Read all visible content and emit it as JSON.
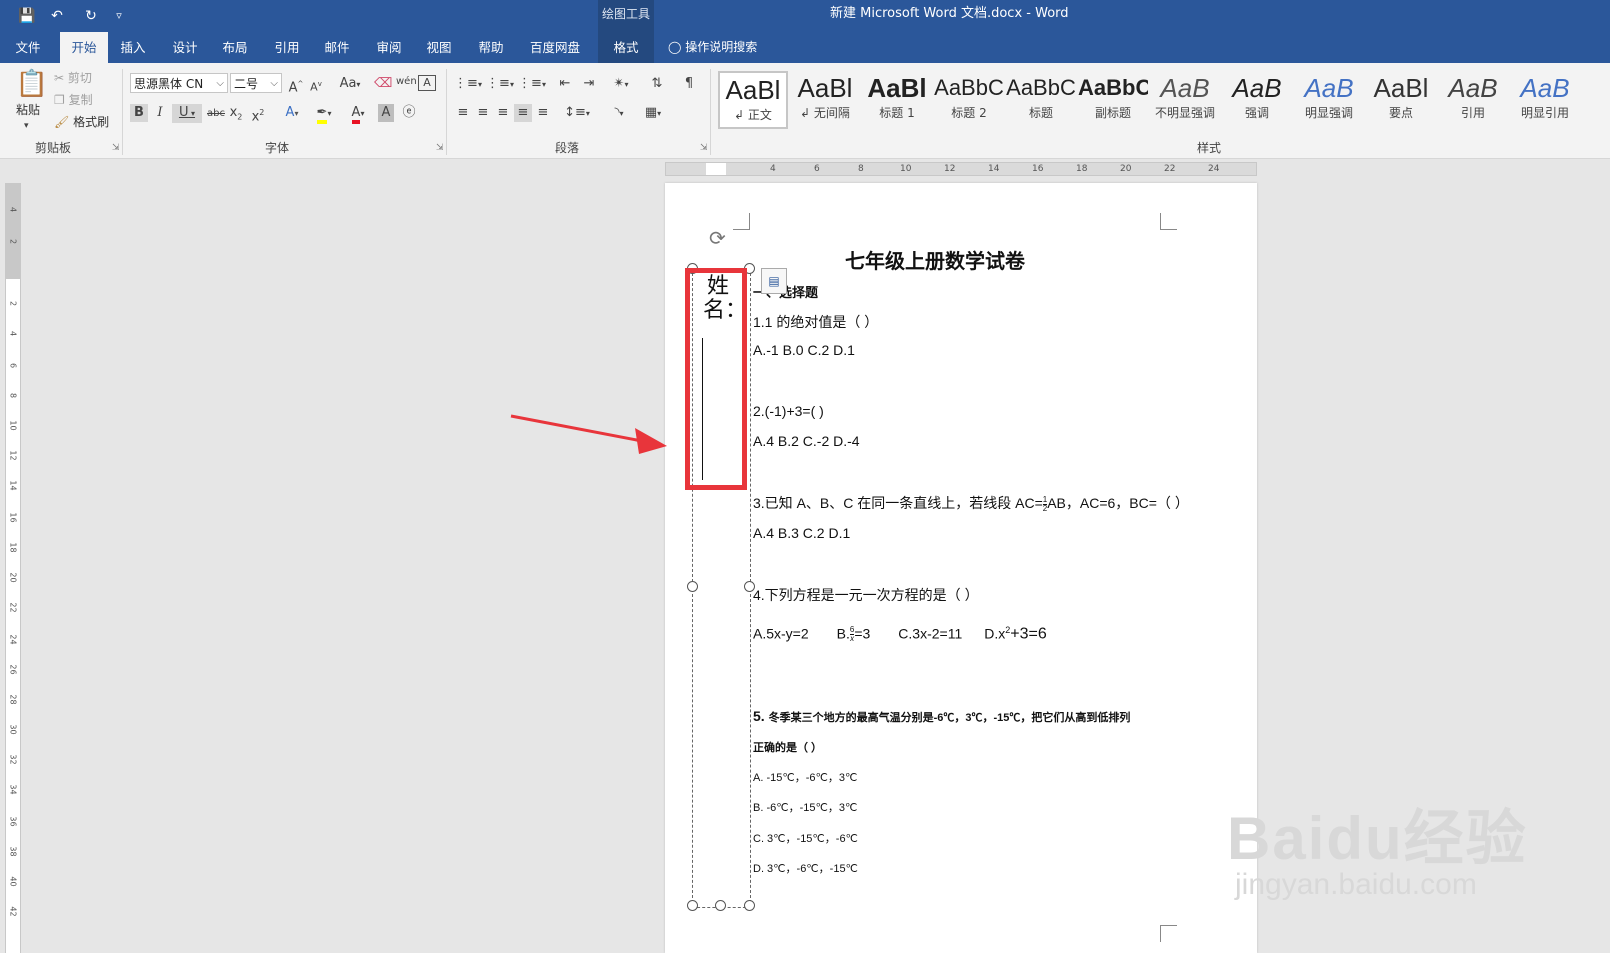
{
  "window": {
    "title": "新建 Microsoft Word 文档.docx  -  Word",
    "context_tools": "绘图工具",
    "accent": "#2b579a"
  },
  "quick_access": [
    "save-icon",
    "undo-icon",
    "redo-icon",
    "customize-icon"
  ],
  "tabs": [
    "文件",
    "开始",
    "插入",
    "设计",
    "布局",
    "引用",
    "邮件",
    "审阅",
    "视图",
    "帮助",
    "百度网盘",
    "格式"
  ],
  "active_tab": "开始",
  "tell_me": "操作说明搜索",
  "ribbon": {
    "clipboard": {
      "paste": "粘贴",
      "cut": "剪切",
      "copy": "复制",
      "format_painter": "格式刷",
      "label": "剪贴板"
    },
    "font": {
      "font_name": "思源黑体 CN",
      "font_size": "二号",
      "change_case": "Aa",
      "label": "字体"
    },
    "paragraph": {
      "label": "段落"
    },
    "styles": {
      "label": "样式",
      "items": [
        {
          "sample": "AaBl",
          "name": "正文"
        },
        {
          "sample": "AaBl",
          "name": "无间隔"
        },
        {
          "sample": "AaBl",
          "name": "标题 1"
        },
        {
          "sample": "AaBbC",
          "name": "标题 2"
        },
        {
          "sample": "AaBbC",
          "name": "标题"
        },
        {
          "sample": "AaBbC",
          "name": "副标题"
        },
        {
          "sample": "AaB",
          "name": "不明显强调"
        },
        {
          "sample": "AaB",
          "name": "强调"
        },
        {
          "sample": "AaB",
          "name": "明显强调"
        },
        {
          "sample": "AaBl",
          "name": "要点"
        },
        {
          "sample": "AaB",
          "name": "引用"
        },
        {
          "sample": "AaB",
          "name": "明显引用"
        }
      ]
    }
  },
  "ruler": {
    "h_ticks": [
      "2",
      "4",
      "6",
      "8",
      "10",
      "12",
      "14",
      "16",
      "18",
      "20",
      "22",
      "24"
    ],
    "v_ticks": [
      "4",
      "2",
      "2",
      "4",
      "6",
      "8",
      "10",
      "12",
      "14",
      "16",
      "18",
      "20",
      "22",
      "24",
      "26",
      "28",
      "30",
      "32",
      "34",
      "36",
      "38",
      "40",
      "42"
    ]
  },
  "document": {
    "title": "七年级上册数学试卷",
    "section": "一、选择题",
    "textbox_text": "姓名：",
    "lines": {
      "q1": "1.1 的绝对值是（    ）",
      "q1_opts": "A.-1      B.0      C.2      D.1",
      "q2": "2.(-1)+3=(    )",
      "q2_opts": "A.4      B.2      C.-2      D.-4",
      "q3_a": "3.已知 A、B、C 在同一条直线上，若线段 AC=",
      "q3_frac_num": "1",
      "q3_frac_den": "2",
      "q3_b": "AB，AC=6，BC=（     ）",
      "q3_opts": "A.4      B.3      C.2      D.1",
      "q4": "4.下列方程是一元一次方程的是（     ）",
      "q4_a": "A.5x-y=2",
      "q4_b_pre": "B.",
      "q4_b_num": "6",
      "q4_b_den": "x",
      "q4_b_post": "=3",
      "q4_c": "C.3x-2=11",
      "q4_d_pre": "D.x",
      "q4_d_sup": "2",
      "q4_d_post": "+3=6",
      "q5_num": "5.",
      "q5": "冬季某三个地方的最高气温分别是-6℃，3℃，-15℃，把它们从高到低排列",
      "q5_cont": "正确的是（     ）",
      "q5_a": "A. -15℃，-6℃，3℃",
      "q5_b": "B. -6℃，-15℃，3℃",
      "q5_c": "C. 3℃，-15℃，-6℃",
      "q5_d": "D. 3℃，-6℃，-15℃"
    }
  },
  "annotation": {
    "color": "#e8353b"
  },
  "watermark": {
    "logo": "Baidu经验",
    "url": "jingyan.baidu.com"
  }
}
